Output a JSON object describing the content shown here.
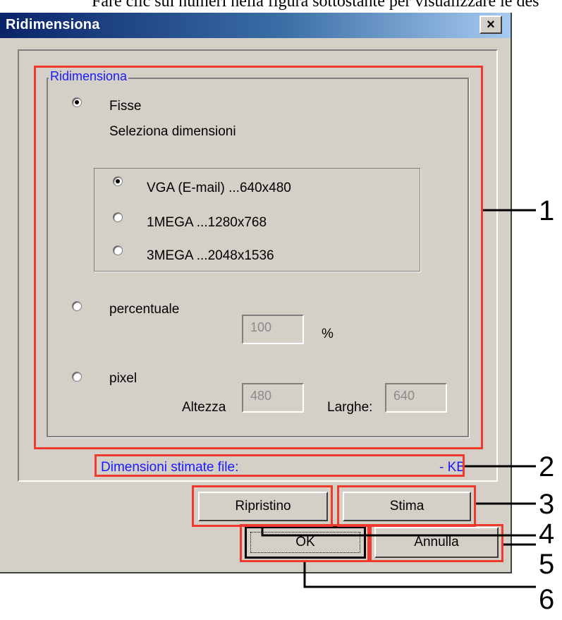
{
  "caption": "Fare clic sui numeri nella figura sottostante per visualizzare le des",
  "dialog": {
    "title": "Ridimensiona",
    "close_symbol": "×"
  },
  "group": {
    "legend": "Ridimensiona",
    "fixed_label": "Fisse",
    "select_dims_label": "Seleziona dimensioni",
    "size_options": [
      {
        "label": "VGA (E-mail) ...640x480",
        "selected": true
      },
      {
        "label": "1MEGA ...1280x768",
        "selected": false
      },
      {
        "label": "3MEGA ...2048x1536",
        "selected": false
      }
    ],
    "percent_label": "percentuale",
    "percent_value": "100",
    "percent_unit": "%",
    "pixel_label": "pixel",
    "height_label": "Altezza",
    "height_value": "480",
    "width_label": "Larghe:",
    "width_value": "640"
  },
  "estimate": {
    "label": "Dimensioni stimate file:",
    "value": "- KB"
  },
  "buttons": {
    "reset": "Ripristino",
    "estimate": "Stima",
    "ok": "OK",
    "cancel": "Annulla"
  },
  "callouts": [
    "1",
    "2",
    "3",
    "4",
    "5",
    "6"
  ],
  "colors": {
    "callout_red": "#f03a2e",
    "accent_blue": "#1a1aff",
    "titlebar_start": "#0a246a",
    "dialog_bg": "#d4d0c8"
  }
}
